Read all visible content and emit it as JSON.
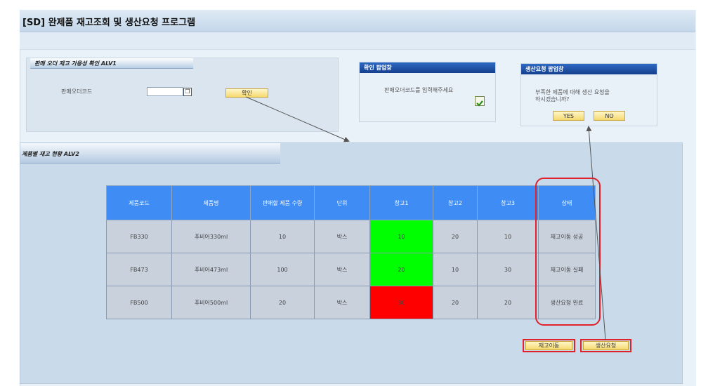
{
  "window": {
    "title": "[SD] 완제품 재고조회 및 생산요청 프로그램"
  },
  "order_panel": {
    "header": "판매 오더 재고 가용성 확인 ALV1",
    "field_label": "판매오더코드",
    "input_value": "",
    "confirm_button": "확인"
  },
  "confirm_popup": {
    "title": "확인 팝업창",
    "message": "판매오더코드를 입력해주세요"
  },
  "production_popup": {
    "title": "생산요청 팝업창",
    "message_line1": "부족한 제품에 대해 생산 요청을",
    "message_line2": "하시겠습니까?",
    "yes_button": "YES",
    "no_button": "NO"
  },
  "stock_panel": {
    "header": "제품별 재고 현황 ALV2",
    "columns": [
      "제품코드",
      "제품명",
      "판매할 제품 수량",
      "단위",
      "창고1",
      "창고2",
      "창고3",
      "상태"
    ],
    "rows": [
      [
        "FB330",
        "푸비어330ml",
        "10",
        "박스",
        "10",
        "20",
        "10",
        "재고이동 성공"
      ],
      [
        "FB473",
        "푸비어473ml",
        "100",
        "박스",
        "20",
        "10",
        "30",
        "재고이동 실패"
      ],
      [
        "FB500",
        "푸비어500ml",
        "20",
        "박스",
        "30",
        "20",
        "20",
        "생산요청 완료"
      ]
    ],
    "warehouse1_colors": [
      "#00ff00",
      "#00ff00",
      "#ff0000"
    ],
    "move_button": "재고이동",
    "production_button": "생산요청"
  },
  "colors": {
    "header_blue": "#3f8cf4",
    "highlight_red": "#e0202a"
  }
}
